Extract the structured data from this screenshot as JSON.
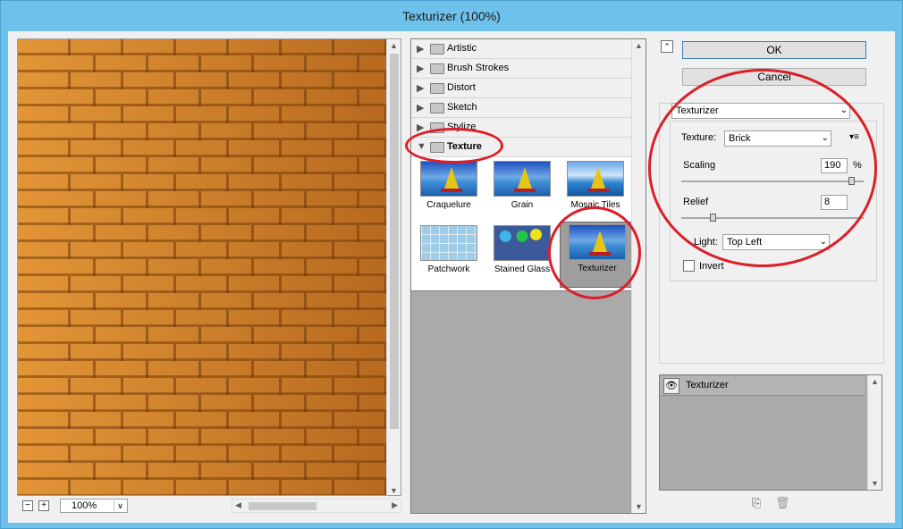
{
  "window": {
    "title": "Texturizer (100%)"
  },
  "preview": {
    "zoom_value": "100%",
    "zoom_out_label": "−",
    "zoom_in_label": "+",
    "scroll_up_icon": "▲",
    "scroll_down_icon": "▼",
    "scroll_left_icon": "◀",
    "scroll_right_icon": "▶",
    "dropdown_icon": "∨"
  },
  "gallery": {
    "categories": [
      {
        "label": "Artistic",
        "state": "collapsed",
        "icon": "▶"
      },
      {
        "label": "Brush Strokes",
        "state": "collapsed",
        "icon": "▶"
      },
      {
        "label": "Distort",
        "state": "collapsed",
        "icon": "▶"
      },
      {
        "label": "Sketch",
        "state": "collapsed",
        "icon": "▶"
      },
      {
        "label": "Stylize",
        "state": "collapsed",
        "icon": "▶"
      },
      {
        "label": "Texture",
        "state": "expanded",
        "icon": "▼"
      }
    ],
    "filters": [
      {
        "label": "Craquelure"
      },
      {
        "label": "Grain"
      },
      {
        "label": "Mosaic Tiles"
      },
      {
        "label": "Patchwork"
      },
      {
        "label": "Stained Glass"
      },
      {
        "label": "Texturizer",
        "selected": true
      }
    ]
  },
  "actions": {
    "ok_label": "OK",
    "cancel_label": "Cancel",
    "collapse_icon": "⌃"
  },
  "settings": {
    "filter_select": "Texturizer",
    "texture_label": "Texture:",
    "texture_value": "Brick",
    "texture_menu_icon": "▾≡",
    "scaling_label": "Scaling",
    "scaling_value": "190",
    "scaling_unit": "%",
    "scaling_level": 0.95,
    "relief_label": "Relief",
    "relief_value": "8",
    "relief_level": 0.16,
    "light_label": "Light:",
    "light_value": "Top Left",
    "invert_label": "Invert",
    "invert_checked": false
  },
  "layers": {
    "rows": [
      {
        "label": "Texturizer",
        "visible": true
      }
    ],
    "eye_icon": "👁",
    "new_layer_icon": "⎘",
    "delete_icon": "🗑"
  },
  "colors": {
    "title_bar": "#6ec1ea",
    "brick": "#d8882b",
    "annotation": "#dc1e28",
    "gallery_bg": "#aaaaaa"
  }
}
